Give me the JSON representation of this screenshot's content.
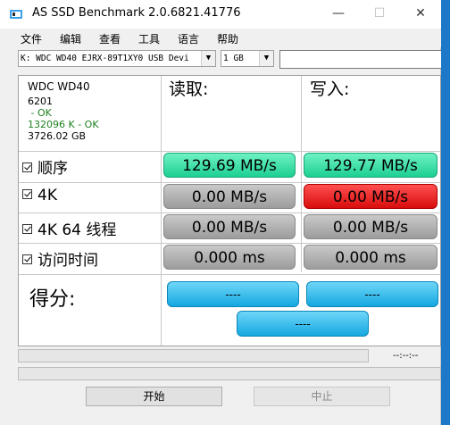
{
  "titlebar": {
    "title": "AS SSD Benchmark 2.0.6821.41776",
    "minimize": "—",
    "maximize": "☐",
    "close": "✕"
  },
  "menu": [
    "文件",
    "编辑",
    "查看",
    "工具",
    "语言",
    "帮助"
  ],
  "toolbar": {
    "drive": "K: WDC WD40 EJRX-89T1XY0 USB Devi",
    "size": "1 GB"
  },
  "drive_info": {
    "model": "WDC WD40",
    "firmware": "6201",
    "status1": " - OK",
    "status2": "132096 K - OK",
    "capacity": "3726.02 GB"
  },
  "headers": {
    "read": "读取:",
    "write": "写入:"
  },
  "rows": [
    {
      "label": "顺序",
      "read": "129.69 MB/s",
      "write": "129.77 MB/s",
      "read_color": "green",
      "write_color": "green"
    },
    {
      "label": "4K",
      "read": "0.00 MB/s",
      "write": "0.00 MB/s",
      "read_color": "gray",
      "write_color": "red"
    },
    {
      "label": "4K 64 线程",
      "read": "0.00 MB/s",
      "write": "0.00 MB/s",
      "read_color": "gray",
      "write_color": "gray"
    },
    {
      "label": "访问时间",
      "read": "0.000 ms",
      "write": "0.000 ms",
      "read_color": "gray",
      "write_color": "gray"
    }
  ],
  "score": {
    "label": "得分:",
    "read": "----",
    "write": "----",
    "total": "----"
  },
  "progress": {
    "timer": "--:--:--"
  },
  "buttons": {
    "start": "开始",
    "stop": "中止"
  },
  "colors": {
    "green": "#1dcf92",
    "gray": "#a8a8a8",
    "red": "#e01010",
    "score": "#14a8e0"
  }
}
